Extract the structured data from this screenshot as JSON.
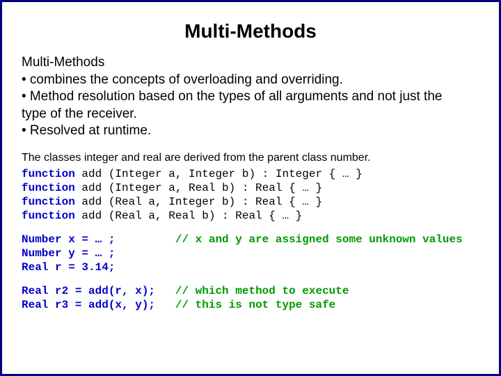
{
  "title": "Multi-Methods",
  "subtitle": "Multi-Methods",
  "bullets": {
    "b1": " •  combines the concepts of overloading and overriding.",
    "b2": " •  Method resolution based on the types of all arguments and not just the",
    "b2b": "type of the receiver.",
    "b3": " •  Resolved at runtime."
  },
  "intro": "The classes integer and real are derived from the parent class number.",
  "fn": {
    "kw": "function",
    "l1": " add (Integer a, Integer b) : Integer { … }",
    "l2": " add (Integer a, Real b) : Real { … }",
    "l3": " add (Real a, Integer b) : Real { … }",
    "l4": " add (Real a, Real b) : Real { … }"
  },
  "assign": {
    "a1": "Number x = … ;         ",
    "c1": "// x and y are assigned some unknown values",
    "a2": "Number y = … ;",
    "a3": "Real r = 3.14;"
  },
  "calls": {
    "r2a": "Real r2 = add(r, x);   ",
    "r2c": "// which method to execute",
    "r3a": "Real r3 = add(x, y);   ",
    "r3c": "// this is not type safe"
  }
}
